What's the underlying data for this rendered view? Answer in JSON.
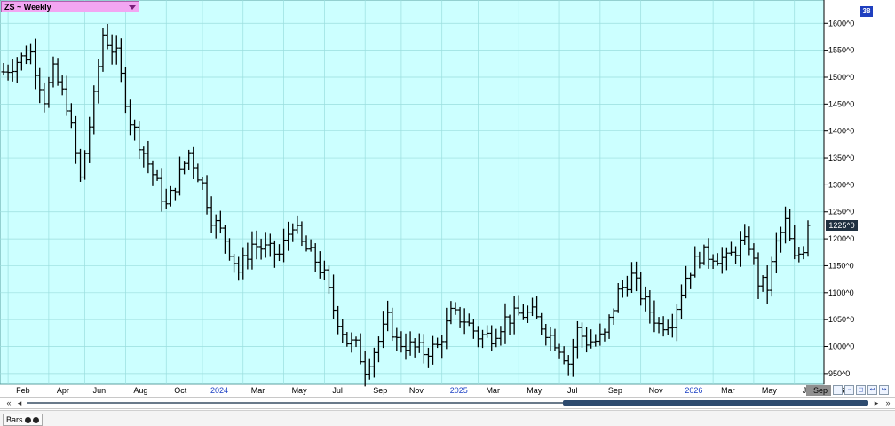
{
  "title": "ZS ~ Weekly",
  "badge": "38",
  "last_price_label": "1225^0",
  "scroll": {
    "first": "«",
    "prev": "◂",
    "next": "▸",
    "last": "»"
  },
  "bottom_tab": "Bars",
  "colors": {
    "plot_bg": "#ccffff",
    "grid": "#9adede",
    "bars": "#000000",
    "axis_text": "#000000",
    "year_text": "#1a3fc4",
    "title_bg": "#f2a6f2"
  },
  "chart_data": {
    "type": "ohlc-bar",
    "series_color": "#000000",
    "y_ticks": [
      "950^0",
      "1000^0",
      "1050^0",
      "1100^0",
      "1150^0",
      "1200^0",
      "1250^0",
      "1300^0",
      "1350^0",
      "1400^0",
      "1450^0",
      "1500^0",
      "1550^0",
      "1600^0"
    ],
    "y_tick_values": [
      950,
      1000,
      1050,
      1100,
      1150,
      1200,
      1250,
      1300,
      1350,
      1400,
      1450,
      1500,
      1550,
      1600
    ],
    "ylim": [
      930,
      1640
    ],
    "last_value": 1225,
    "x_labels": [
      {
        "text": "Feb",
        "week": 1
      },
      {
        "text": "Apr",
        "week": 10
      },
      {
        "text": "Jun",
        "week": 18
      },
      {
        "text": "Aug",
        "week": 27
      },
      {
        "text": "Oct",
        "week": 36
      },
      {
        "text": "2024",
        "week": 44,
        "year": true
      },
      {
        "text": "Mar",
        "week": 53
      },
      {
        "text": "May",
        "week": 62
      },
      {
        "text": "Jul",
        "week": 71
      },
      {
        "text": "Sep",
        "week": 80
      },
      {
        "text": "Nov",
        "week": 88
      },
      {
        "text": "2025",
        "week": 97,
        "year": true
      },
      {
        "text": "Mar",
        "week": 105
      },
      {
        "text": "May",
        "week": 114
      },
      {
        "text": "Jul",
        "week": 123
      },
      {
        "text": "Sep",
        "week": 132
      },
      {
        "text": "Nov",
        "week": 141
      },
      {
        "text": "2026",
        "week": 149,
        "year": true
      },
      {
        "text": "Mar",
        "week": 157
      },
      {
        "text": "May",
        "week": 166
      },
      {
        "text": "Jul",
        "week": 175
      },
      {
        "text": "Sep",
        "week": 183
      }
    ],
    "anchors": [
      [
        0,
        1510
      ],
      [
        3,
        1530
      ],
      [
        6,
        1545
      ],
      [
        9,
        1460
      ],
      [
        11,
        1510
      ],
      [
        14,
        1450
      ],
      [
        17,
        1310
      ],
      [
        20,
        1460
      ],
      [
        22,
        1580
      ],
      [
        25,
        1540
      ],
      [
        28,
        1420
      ],
      [
        31,
        1360
      ],
      [
        34,
        1300
      ],
      [
        36,
        1260
      ],
      [
        39,
        1320
      ],
      [
        41,
        1360
      ],
      [
        44,
        1300
      ],
      [
        46,
        1240
      ],
      [
        49,
        1200
      ],
      [
        52,
        1140
      ],
      [
        55,
        1190
      ],
      [
        58,
        1180
      ],
      [
        61,
        1170
      ],
      [
        64,
        1230
      ],
      [
        66,
        1190
      ],
      [
        69,
        1160
      ],
      [
        71,
        1130
      ],
      [
        73,
        1070
      ],
      [
        76,
        1010
      ],
      [
        78,
        1000
      ],
      [
        80,
        960
      ],
      [
        83,
        1010
      ],
      [
        85,
        1050
      ],
      [
        87,
        1010
      ],
      [
        90,
        1000
      ],
      [
        93,
        990
      ],
      [
        96,
        1000
      ],
      [
        99,
        1060
      ],
      [
        102,
        1050
      ],
      [
        105,
        1020
      ],
      [
        108,
        1020
      ],
      [
        111,
        1050
      ],
      [
        114,
        1060
      ],
      [
        117,
        1060
      ],
      [
        120,
        1030
      ],
      [
        123,
        1000
      ],
      [
        125,
        970
      ],
      [
        127,
        1030
      ],
      [
        129,
        1010
      ],
      [
        131,
        1010
      ],
      [
        133,
        1020
      ],
      [
        136,
        1100
      ],
      [
        139,
        1130
      ],
      [
        142,
        1080
      ],
      [
        145,
        1040
      ],
      [
        148,
        1050
      ],
      [
        151,
        1130
      ],
      [
        154,
        1170
      ],
      [
        157,
        1170
      ],
      [
        160,
        1160
      ],
      [
        163,
        1190
      ],
      [
        165,
        1190
      ],
      [
        167,
        1120
      ],
      [
        169,
        1110
      ],
      [
        171,
        1190
      ],
      [
        173,
        1230
      ],
      [
        175,
        1160
      ],
      [
        177,
        1185
      ],
      [
        178,
        1225
      ]
    ],
    "total_weeks": 179
  }
}
